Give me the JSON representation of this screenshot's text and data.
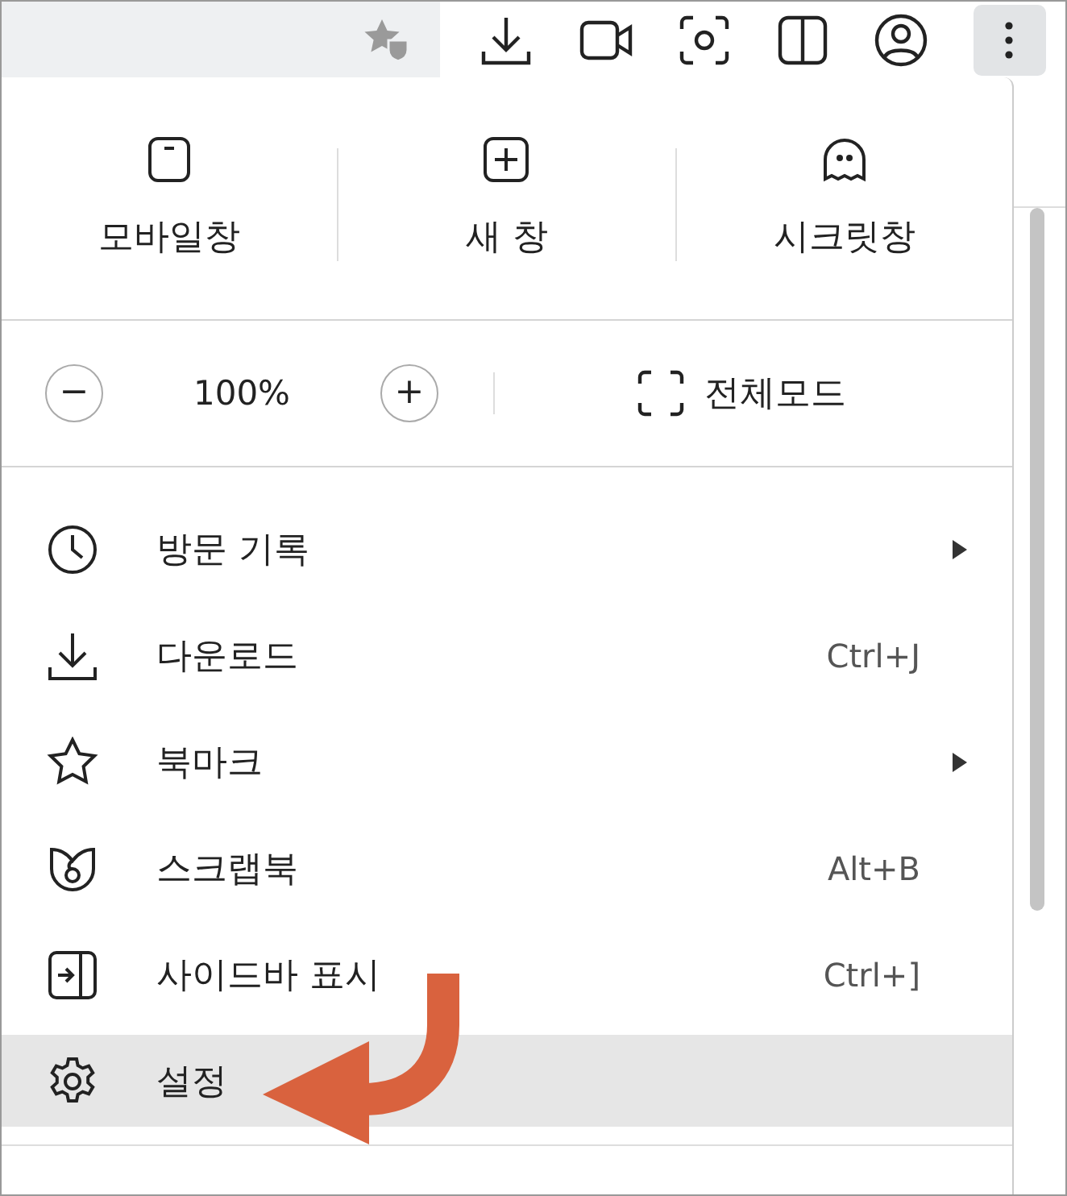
{
  "quick_actions": [
    {
      "label": "모바일창"
    },
    {
      "label": "새 창"
    },
    {
      "label": "시크릿창"
    }
  ],
  "zoom": {
    "minus": "−",
    "value": "100%",
    "plus": "+",
    "fullscreen": "전체모드"
  },
  "menu_items": [
    {
      "label": "방문 기록",
      "submenu": true,
      "selected": false
    },
    {
      "label": "다운로드",
      "shortcut": "Ctrl+J",
      "submenu": false,
      "selected": false
    },
    {
      "label": "북마크",
      "submenu": true,
      "selected": false
    },
    {
      "label": "스크랩북",
      "shortcut": "Alt+B",
      "submenu": false,
      "selected": false
    },
    {
      "label": "사이드바 표시",
      "shortcut": "Ctrl+]",
      "submenu": false,
      "selected": false
    },
    {
      "label": "설정",
      "submenu": false,
      "selected": true
    }
  ]
}
